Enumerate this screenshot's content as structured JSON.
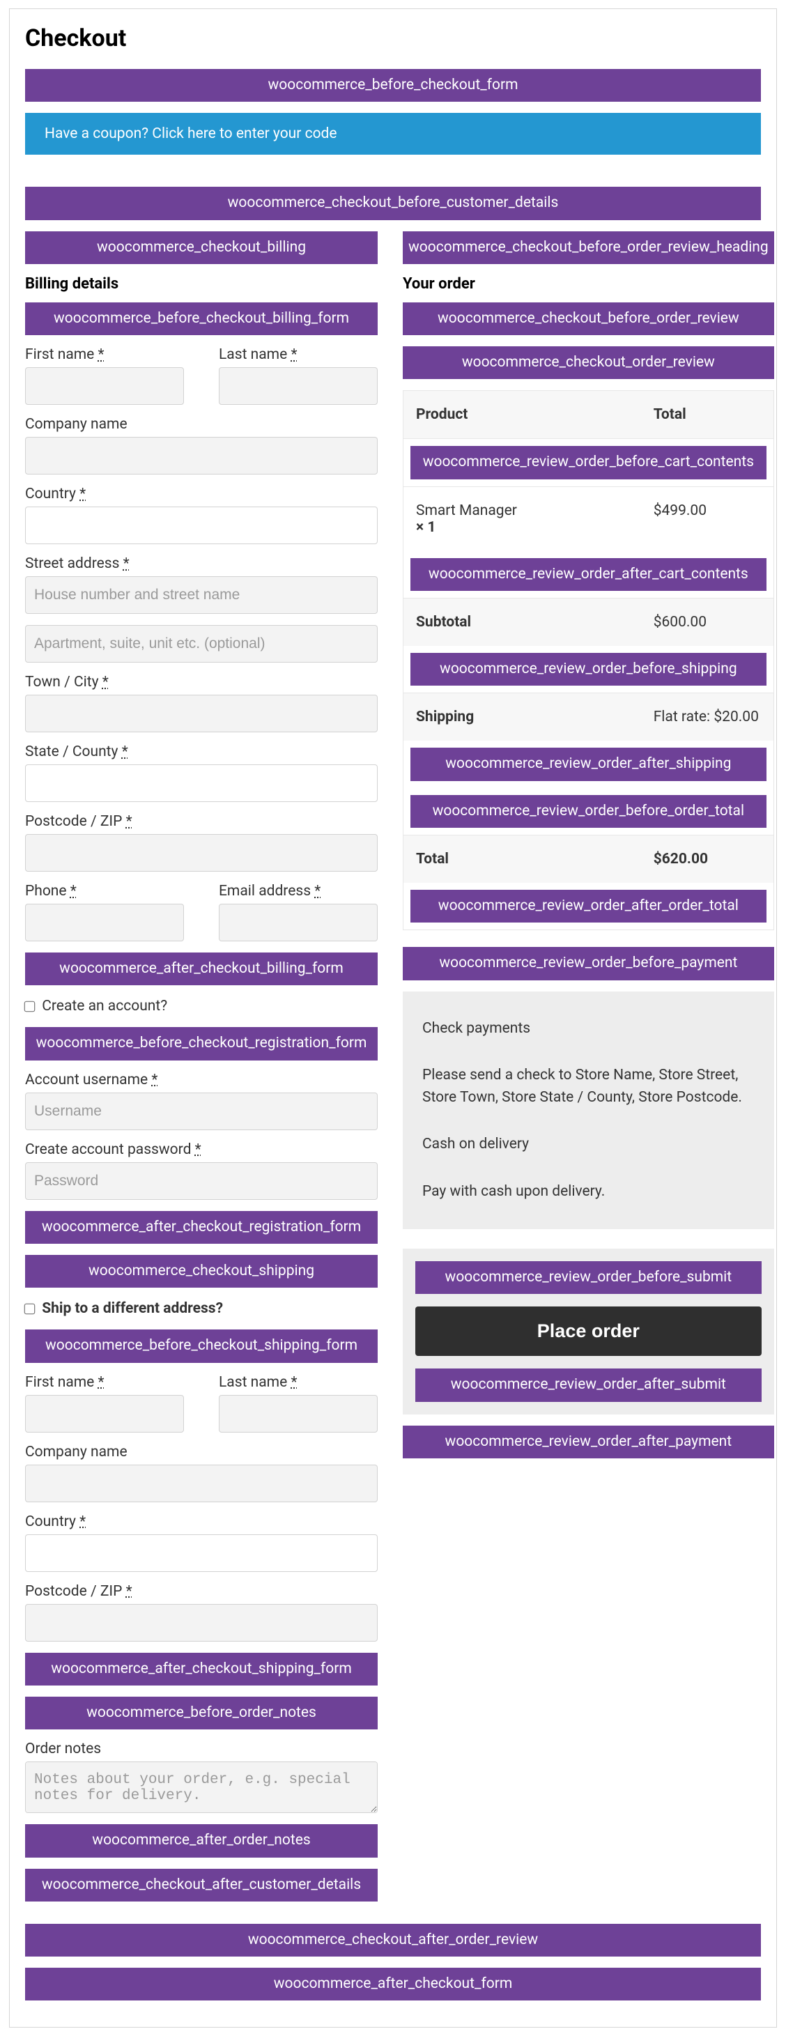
{
  "title": "Checkout",
  "coupon_notice": "Have a coupon? Click here to enter your code",
  "hooks": {
    "before_checkout_form": "woocommerce_before_checkout_form",
    "checkout_before_customer_details": "woocommerce_checkout_before_customer_details",
    "checkout_billing": "woocommerce_checkout_billing",
    "before_checkout_billing_form": "woocommerce_before_checkout_billing_form",
    "after_checkout_billing_form": "woocommerce_after_checkout_billing_form",
    "before_checkout_registration_form": "woocommerce_before_checkout_registration_form",
    "after_checkout_registration_form": "woocommerce_after_checkout_registration_form",
    "checkout_shipping": "woocommerce_checkout_shipping",
    "before_checkout_shipping_form": "woocommerce_before_checkout_shipping_form",
    "after_checkout_shipping_form": "woocommerce_after_checkout_shipping_form",
    "before_order_notes": "woocommerce_before_order_notes",
    "after_order_notes": "woocommerce_after_order_notes",
    "checkout_after_customer_details": "woocommerce_checkout_after_customer_details",
    "checkout_before_order_review_heading": "woocommerce_checkout_before_order_review_heading",
    "checkout_before_order_review": "woocommerce_checkout_before_order_review",
    "checkout_order_review": "woocommerce_checkout_order_review",
    "review_order_before_cart_contents": "woocommerce_review_order_before_cart_contents",
    "review_order_after_cart_contents": "woocommerce_review_order_after_cart_contents",
    "review_order_before_shipping": "woocommerce_review_order_before_shipping",
    "review_order_after_shipping": "woocommerce_review_order_after_shipping",
    "review_order_before_order_total": "woocommerce_review_order_before_order_total",
    "review_order_after_order_total": "woocommerce_review_order_after_order_total",
    "review_order_before_payment": "woocommerce_review_order_before_payment",
    "review_order_before_submit": "woocommerce_review_order_before_submit",
    "review_order_after_submit": "woocommerce_review_order_after_submit",
    "review_order_after_payment": "woocommerce_review_order_after_payment",
    "checkout_after_order_review": "woocommerce_checkout_after_order_review",
    "after_checkout_form": "woocommerce_after_checkout_form"
  },
  "billing": {
    "heading": "Billing details",
    "first_name": "First name ",
    "last_name": "Last name ",
    "company": "Company name",
    "country": "Country ",
    "street": "Street address ",
    "street_ph": "House number and street name",
    "street2_ph": "Apartment, suite, unit etc. (optional)",
    "city": "Town / City ",
    "state": "State / County ",
    "postcode": "Postcode / ZIP ",
    "phone": "Phone ",
    "email": "Email address ",
    "req": "*"
  },
  "account": {
    "create_label": "Create an account?",
    "username_label": "Account username ",
    "username_ph": "Username",
    "password_label": "Create account password ",
    "password_ph": "Password"
  },
  "shipping": {
    "diff_label": "Ship to a different address?",
    "first_name": "First name ",
    "last_name": "Last name ",
    "company": "Company name",
    "country": "Country ",
    "postcode": "Postcode / ZIP "
  },
  "notes": {
    "label": "Order notes",
    "ph": "Notes about your order, e.g. special notes for delivery."
  },
  "order": {
    "heading": "Your order",
    "col_product": "Product",
    "col_total": "Total",
    "item_name": "Smart Manager",
    "item_qty": "× 1",
    "item_total": "$499.00",
    "subtotal_label": "Subtotal",
    "subtotal_value": "$600.00",
    "shipping_label": "Shipping",
    "shipping_value": "Flat rate: $20.00",
    "total_label": "Total",
    "total_value": "$620.00"
  },
  "payment": {
    "check_title": "Check payments",
    "check_desc": "Please send a check to Store Name, Store Street, Store Town, Store State / County, Store Postcode.",
    "cod_title": "Cash on delivery",
    "cod_desc": "Pay with cash upon delivery.",
    "place_order": "Place order"
  }
}
